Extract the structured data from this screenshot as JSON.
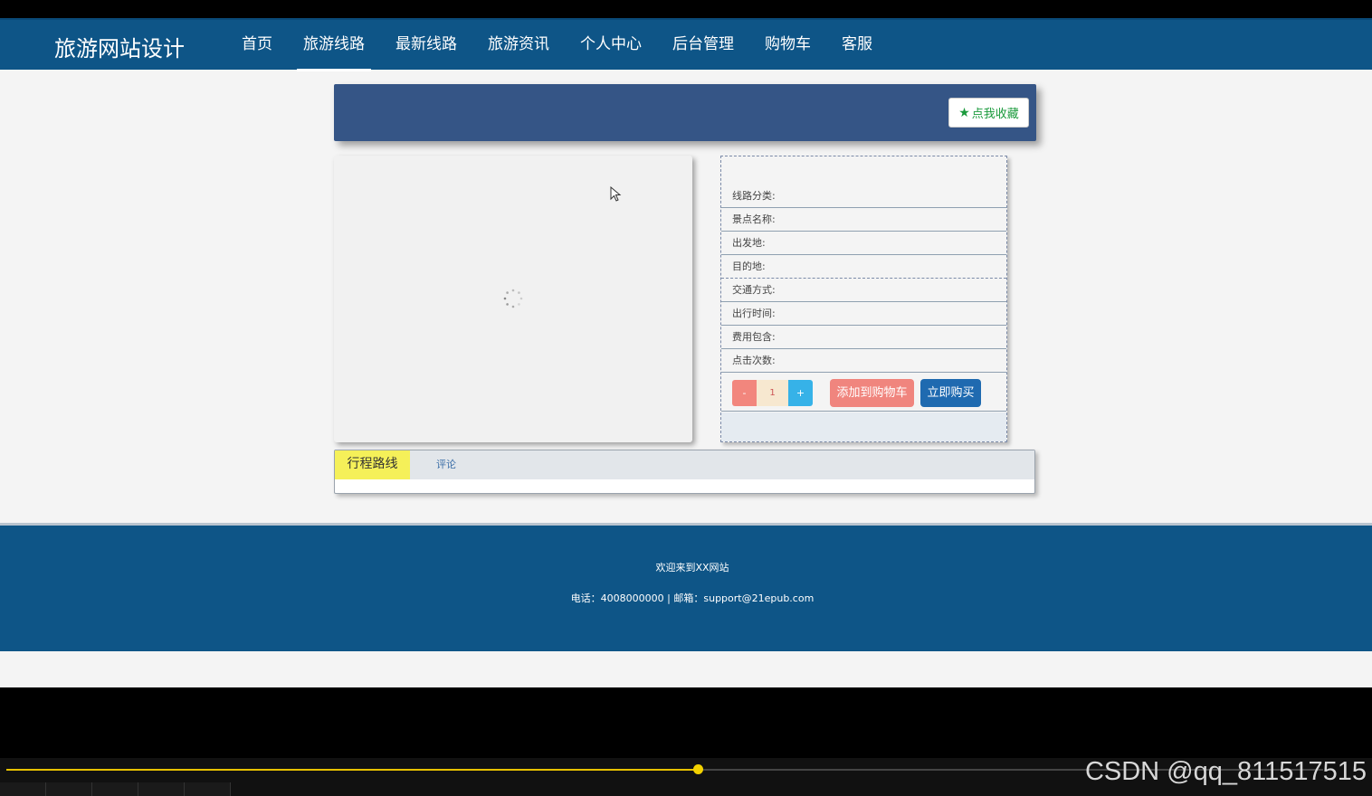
{
  "nav": {
    "brand": "旅游网站设计",
    "items": [
      {
        "label": "首页",
        "active": false
      },
      {
        "label": "旅游线路",
        "active": true
      },
      {
        "label": "最新线路",
        "active": false
      },
      {
        "label": "旅游资讯",
        "active": false
      },
      {
        "label": "个人中心",
        "active": false
      },
      {
        "label": "后台管理",
        "active": false
      },
      {
        "label": "购物车",
        "active": false
      },
      {
        "label": "客服",
        "active": false
      }
    ]
  },
  "banner": {
    "favorite_label": "点我收藏",
    "favorite_icon": "star-icon"
  },
  "image_panel": {
    "loading_icon": "spinner-icon"
  },
  "info": {
    "rows": [
      "线路分类:",
      "景点名称:",
      "出发地:",
      "目的地:",
      "交通方式:",
      "出行时间:",
      "费用包含:",
      "点击次数:"
    ],
    "qty_minus": "-",
    "qty_value": "1",
    "qty_plus": "+",
    "add_to_cart": "添加到购物车",
    "buy_now": "立即购买"
  },
  "tabs": {
    "itinerary": "行程路线",
    "comments": "评论"
  },
  "footer": {
    "welcome": "欢迎来到XX网站",
    "contact": "电话：4008000000 | 邮箱：support@21epub.com"
  },
  "player": {
    "progress": 0.525,
    "watermark": "CSDN @qq_811517515"
  },
  "colors": {
    "nav_bg": "#0e5587",
    "banner_bg": "#355586",
    "add_cart": "#f0857e",
    "buy_now": "#1f6ab0",
    "tab_active": "#f5f059",
    "progress": "#e8c200"
  }
}
